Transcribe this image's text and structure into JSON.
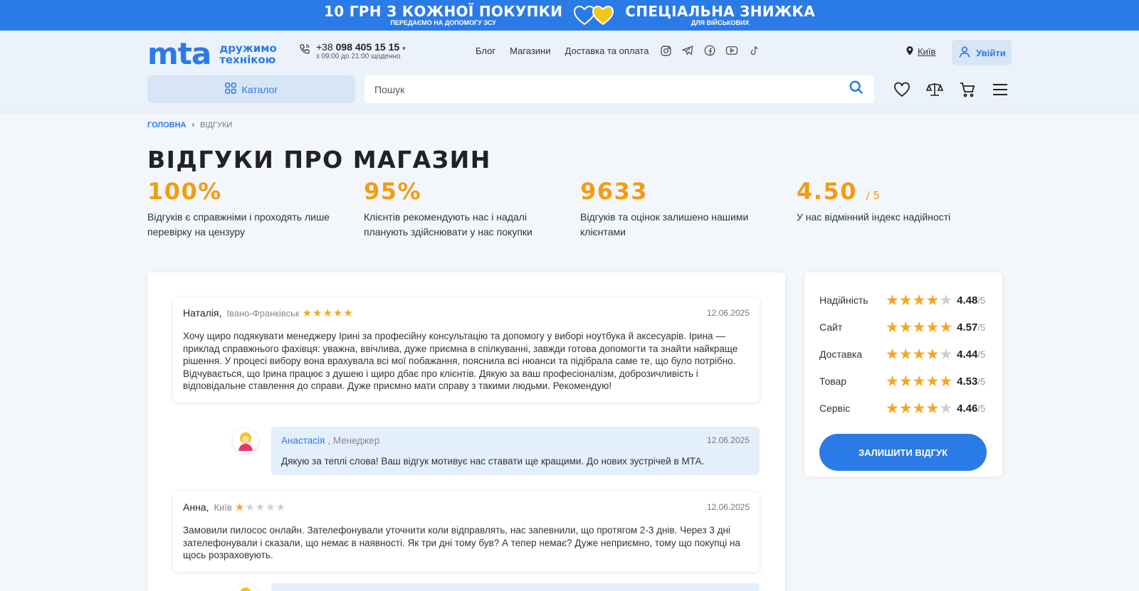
{
  "promo": {
    "left_title": "10 ГРН З КОЖНОЇ ПОКУПКИ",
    "left_sub": "ПЕРЕДАЄМО НА ДОПОМОГУ ЗСУ",
    "right_title": "СПЕЦІАЛЬНА ЗНИЖКА",
    "right_sub": "ДЛЯ ВІЙСЬКОВИХ",
    "heart_colors": [
      "#2b7be6",
      "#f5c518"
    ]
  },
  "header": {
    "logo": "mta",
    "slogan_line1": "дружимо",
    "slogan_line2": "технікою",
    "phone_prefix": "+38",
    "phone_number": "098 405 15 15",
    "hours": "з 09:00 до 21:00 щоденно",
    "nav": [
      "Блог",
      "Магазини",
      "Доставка та оплата"
    ],
    "socials": [
      "instagram-icon",
      "telegram-icon",
      "facebook-icon",
      "youtube-icon",
      "tiktok-icon"
    ],
    "city": "Київ",
    "login": "Увійти",
    "catalog": "Каталог",
    "search_placeholder": "Пошук",
    "icons": [
      "heart-icon",
      "compare-icon",
      "cart-icon",
      "menu-icon"
    ]
  },
  "breadcrumb": {
    "home": "ГОЛОВНА",
    "current": "ВІДГУКИ"
  },
  "page_title": "ВІДГУКИ ПРО МАГАЗИН",
  "stats": [
    {
      "value": "100%",
      "suffix": "",
      "text": "Відгуків є справжніми і проходять лише перевірку на цензуру"
    },
    {
      "value": "95%",
      "suffix": "",
      "text": "Клієнтів рекомендують нас і надалі планують здійснювати у нас покупки"
    },
    {
      "value": "9633",
      "suffix": "",
      "text": "Відгуків та оцінок залишено нашими клієнтами"
    },
    {
      "value": "4.50",
      "suffix": "/ 5",
      "text": "У нас відмінний індекс надійності"
    }
  ],
  "reviews": [
    {
      "author": "Наталія,",
      "city": "Івано-Франківськ",
      "stars": 5,
      "date": "12.06.2025",
      "text": "Хочу щиро подякувати менеджеру Ірині за професійну консультацію та допомогу у виборі ноутбука й аксесуарів. Ірина — приклад справжнього фахівця: уважна, ввічлива, дуже приємна в спілкуванні, завжди готова допомогти та знайти найкраще рішення. У процесі вибору вона врахувала всі мої побажання, пояснила всі нюанси та підібрала саме те, що було потрібно. Відчувається, що Ірина працює з душею і щиро дбає про клієнтів. Дякую за ваш професіоналізм, доброзичливість і відповідальне ставлення до справи. Дуже приємно мати справу з такими людьми. Рекомендую!",
      "reply": {
        "name": "Анастасія",
        "role": ", Менеджер",
        "date": "12.06.2025",
        "text": "Дякую за теплі слова! Ваш відгук мотивує нас ставати ще кращими. До нових зустрічей в МТА."
      }
    },
    {
      "author": "Анна,",
      "city": "Київ",
      "stars": 1,
      "date": "12.06.2025",
      "text": "Замовили пилосос онлайн. Зателефонували уточнити коли відправлять, нас запевнили, що протягом 2-3 днів. Через 3 дні зателефонували і сказали, що немає в наявності. Як три дні тому був? А тепер немає? Дуже неприємно, тому що покупці на щось розраховують."
    }
  ],
  "ratings": [
    {
      "label": "Надійність",
      "stars": 4,
      "value": "4.48",
      "of": "/5"
    },
    {
      "label": "Сайт",
      "stars": 5,
      "value": "4.57",
      "of": "/5"
    },
    {
      "label": "Доставка",
      "stars": 4,
      "value": "4.44",
      "of": "/5"
    },
    {
      "label": "Товар",
      "stars": 5,
      "value": "4.53",
      "of": "/5"
    },
    {
      "label": "Сервіс",
      "stars": 4,
      "value": "4.46",
      "of": "/5"
    }
  ],
  "leave_review": "ЗАЛИШИТИ ВІДГУК",
  "colors": {
    "accent": "#2b7be6",
    "star": "#f5a623",
    "stat": "#f39c12"
  }
}
